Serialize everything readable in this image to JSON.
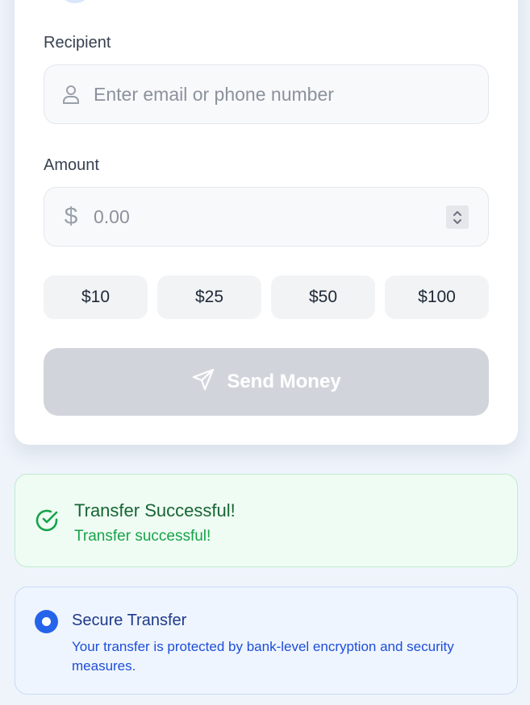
{
  "form": {
    "recipient_label": "Recipient",
    "recipient_placeholder": "Enter email or phone number",
    "recipient_value": "",
    "amount_label": "Amount",
    "amount_placeholder": "0.00",
    "amount_value": "",
    "currency_symbol": "$",
    "quick_amounts": [
      "$10",
      "$25",
      "$50",
      "$100"
    ],
    "send_label": "Send Money"
  },
  "success": {
    "title": "Transfer Successful!",
    "message": "Transfer successful!"
  },
  "secure": {
    "title": "Secure Transfer",
    "description": "Your transfer is protected by bank-level encryption and security measures."
  },
  "icons": {
    "recipient": "user-icon",
    "amount": "dollar-icon",
    "send": "send-icon",
    "success": "check-circle-icon",
    "secure": "radio-selected-icon"
  },
  "colors": {
    "background": "#eff4fb",
    "send_disabled": "#d1d5db",
    "success_bg": "#effcf3",
    "success_text": "#166534",
    "info_bg": "#eff5fe",
    "info_accent": "#2563eb"
  }
}
